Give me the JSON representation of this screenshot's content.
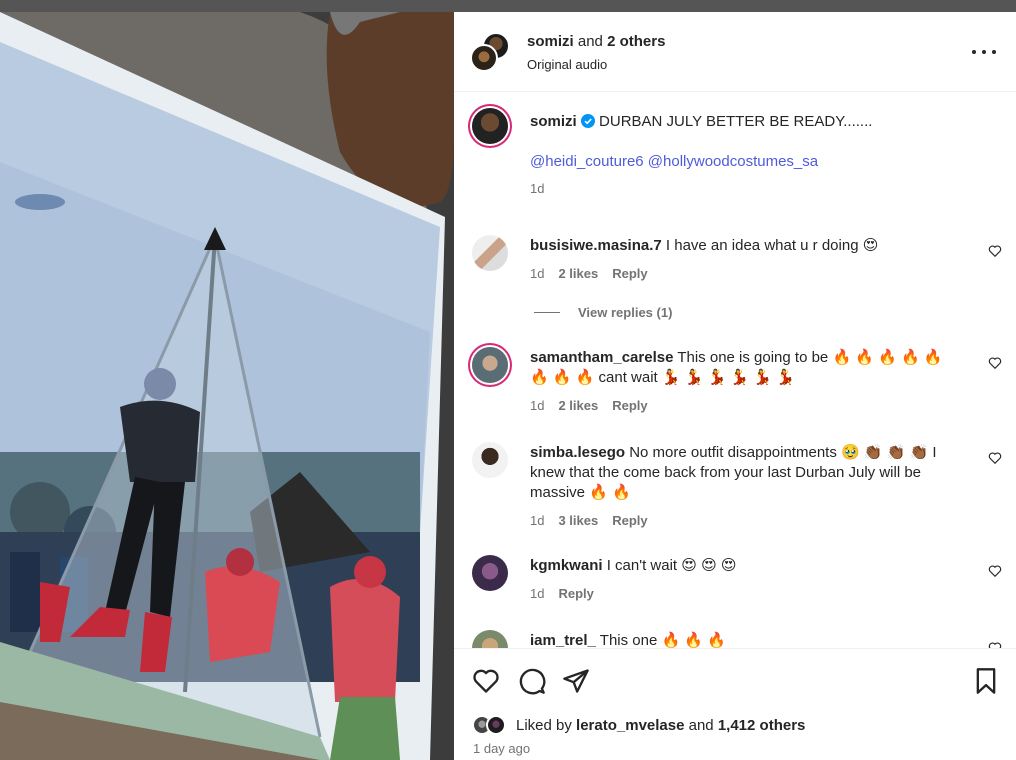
{
  "post": {
    "author_group": "somizi",
    "author_group_suffix": "and",
    "others": "2 others",
    "audio": "Original audio"
  },
  "caption": {
    "username": "somizi",
    "text": "DURBAN JULY BETTER BE READY.......",
    "mentions": "@heidi_couture6 @hollywoodcostumes_sa",
    "time": "1d"
  },
  "comments": [
    {
      "username": "busisiwe.masina.7",
      "text": "I have an idea what u r doing 😍",
      "time": "1d",
      "likes": "2 likes",
      "reply": "Reply",
      "view_replies": "View replies (1)"
    },
    {
      "username": "samantham_carelse",
      "text": "This one is going to be 🔥 🔥 🔥 🔥 🔥 🔥 🔥 🔥 cant wait 💃 💃 💃 💃 💃 💃",
      "time": "1d",
      "likes": "2 likes",
      "reply": "Reply"
    },
    {
      "username": "simba.lesego",
      "text": "No more outfit disappointments 🥹 👏🏾 👏🏾 👏🏾 I knew that the come back from your last Durban July will be massive 🔥 🔥",
      "time": "1d",
      "likes": "3 likes",
      "reply": "Reply"
    },
    {
      "username": "kgmkwani",
      "text": "I can't wait 😍 😍 😍",
      "time": "1d",
      "reply": "Reply"
    },
    {
      "username": "iam_trel_",
      "text": "This one 🔥 🔥 🔥"
    }
  ],
  "footer": {
    "liked_by_prefix": "Liked by",
    "liked_by_user": "lerato_mvelase",
    "and": "and",
    "others_count": "1,412 others",
    "ago": "1 day ago"
  },
  "icons": [
    "more-icon",
    "verified-icon",
    "heart-icon",
    "comment-icon",
    "share-icon",
    "bookmark-icon"
  ],
  "colors": {
    "link": "#4e5bdb",
    "verified": "#0095f6",
    "ring": "#d62976"
  }
}
